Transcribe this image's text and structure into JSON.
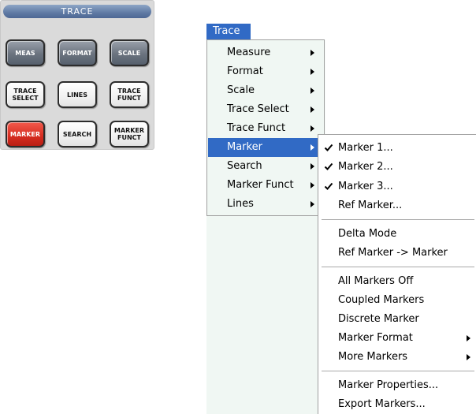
{
  "panel": {
    "title": "TRACE",
    "buttons": [
      {
        "label": "MEAS"
      },
      {
        "label": "FORMAT"
      },
      {
        "label": "SCALE"
      },
      {
        "label": "TRACE\nSELECT"
      },
      {
        "label": "LINES"
      },
      {
        "label": "TRACE\nFUNCT"
      },
      {
        "label": "MARKER"
      },
      {
        "label": "SEARCH"
      },
      {
        "label": "MARKER\nFUNCT"
      }
    ]
  },
  "menubar": {
    "title": "Trace"
  },
  "menu": {
    "items": [
      {
        "label": "Measure"
      },
      {
        "label": "Format"
      },
      {
        "label": "Scale"
      },
      {
        "label": "Trace Select"
      },
      {
        "label": "Trace Funct"
      },
      {
        "label": "Marker"
      },
      {
        "label": "Search"
      },
      {
        "label": "Marker Funct"
      },
      {
        "label": "Lines"
      }
    ]
  },
  "submenu": {
    "items": [
      {
        "label": "Marker 1...",
        "checked": true
      },
      {
        "label": "Marker 2...",
        "checked": true
      },
      {
        "label": "Marker 3...",
        "checked": true
      },
      {
        "label": "Ref Marker..."
      },
      {
        "label": "Delta Mode"
      },
      {
        "label": "Ref Marker -> Marker"
      },
      {
        "label": "All Markers Off"
      },
      {
        "label": "Coupled Markers"
      },
      {
        "label": "Discrete Marker"
      },
      {
        "label": "Marker Format"
      },
      {
        "label": "More Markers"
      },
      {
        "label": "Marker Properties..."
      },
      {
        "label": "Export Markers..."
      }
    ]
  },
  "icons": {
    "check": "check-icon",
    "arrow": "submenu-arrow-icon"
  },
  "colors": {
    "highlight": "#316ac5",
    "menu_background": "#f0f7f3",
    "marker_key": "#d62c20"
  }
}
